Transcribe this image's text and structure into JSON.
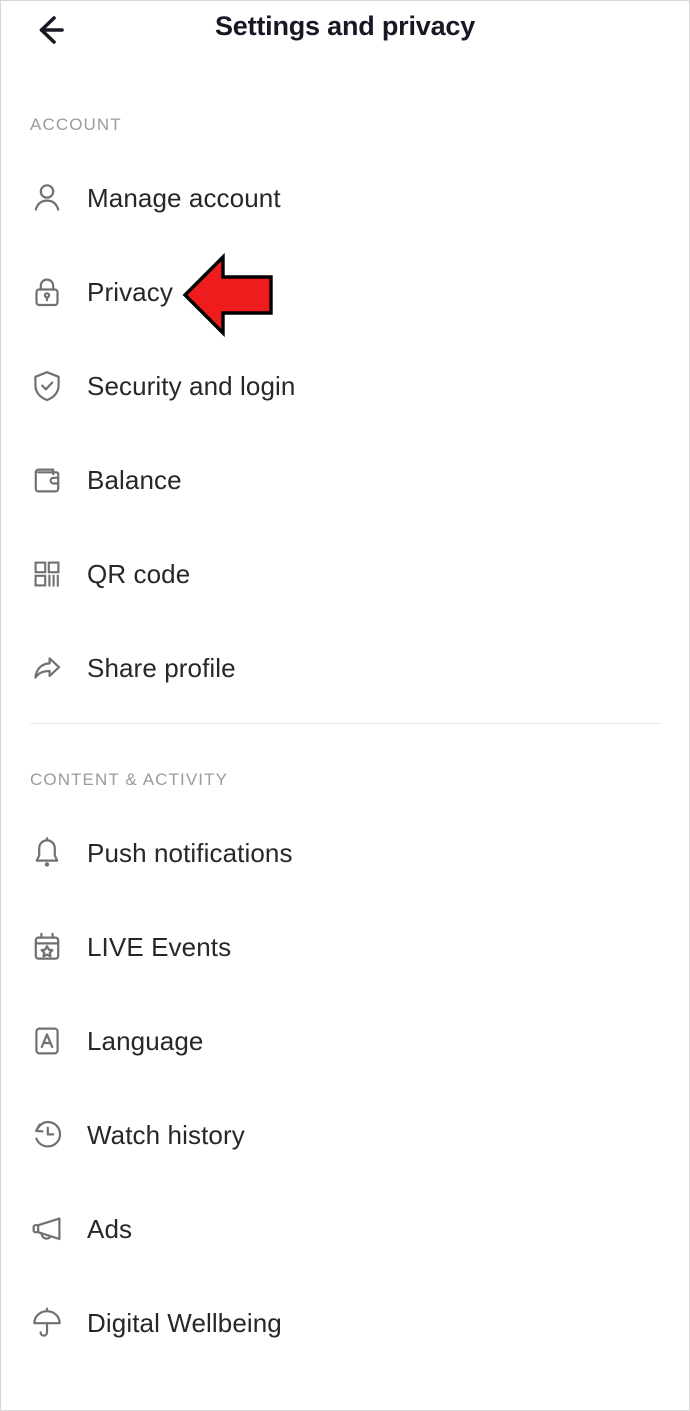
{
  "header": {
    "title": "Settings and privacy",
    "back_icon": "back-arrow-icon"
  },
  "sections": [
    {
      "title": "ACCOUNT",
      "items": [
        {
          "label": "Manage account",
          "icon": "person-icon"
        },
        {
          "label": "Privacy",
          "icon": "lock-icon"
        },
        {
          "label": "Security and login",
          "icon": "shield-check-icon"
        },
        {
          "label": "Balance",
          "icon": "wallet-icon"
        },
        {
          "label": "QR code",
          "icon": "qr-code-icon"
        },
        {
          "label": "Share profile",
          "icon": "share-arrow-icon"
        }
      ]
    },
    {
      "title": "CONTENT & ACTIVITY",
      "items": [
        {
          "label": "Push notifications",
          "icon": "bell-icon"
        },
        {
          "label": "LIVE Events",
          "icon": "calendar-star-icon"
        },
        {
          "label": "Language",
          "icon": "letter-a-box-icon"
        },
        {
          "label": "Watch history",
          "icon": "clock-history-icon"
        },
        {
          "label": "Ads",
          "icon": "megaphone-icon"
        },
        {
          "label": "Digital Wellbeing",
          "icon": "umbrella-icon"
        }
      ]
    }
  ],
  "annotation": {
    "type": "left-pointing-arrow",
    "color": "#EE1C1C",
    "outline_color": "#000000",
    "points_at": "Privacy"
  },
  "colors": {
    "background": "#ffffff",
    "title_text": "#161823",
    "row_text": "#26272b",
    "section_text": "#9b9b9f",
    "icon_stroke": "#6f7074",
    "divider": "#e9e9ea"
  }
}
